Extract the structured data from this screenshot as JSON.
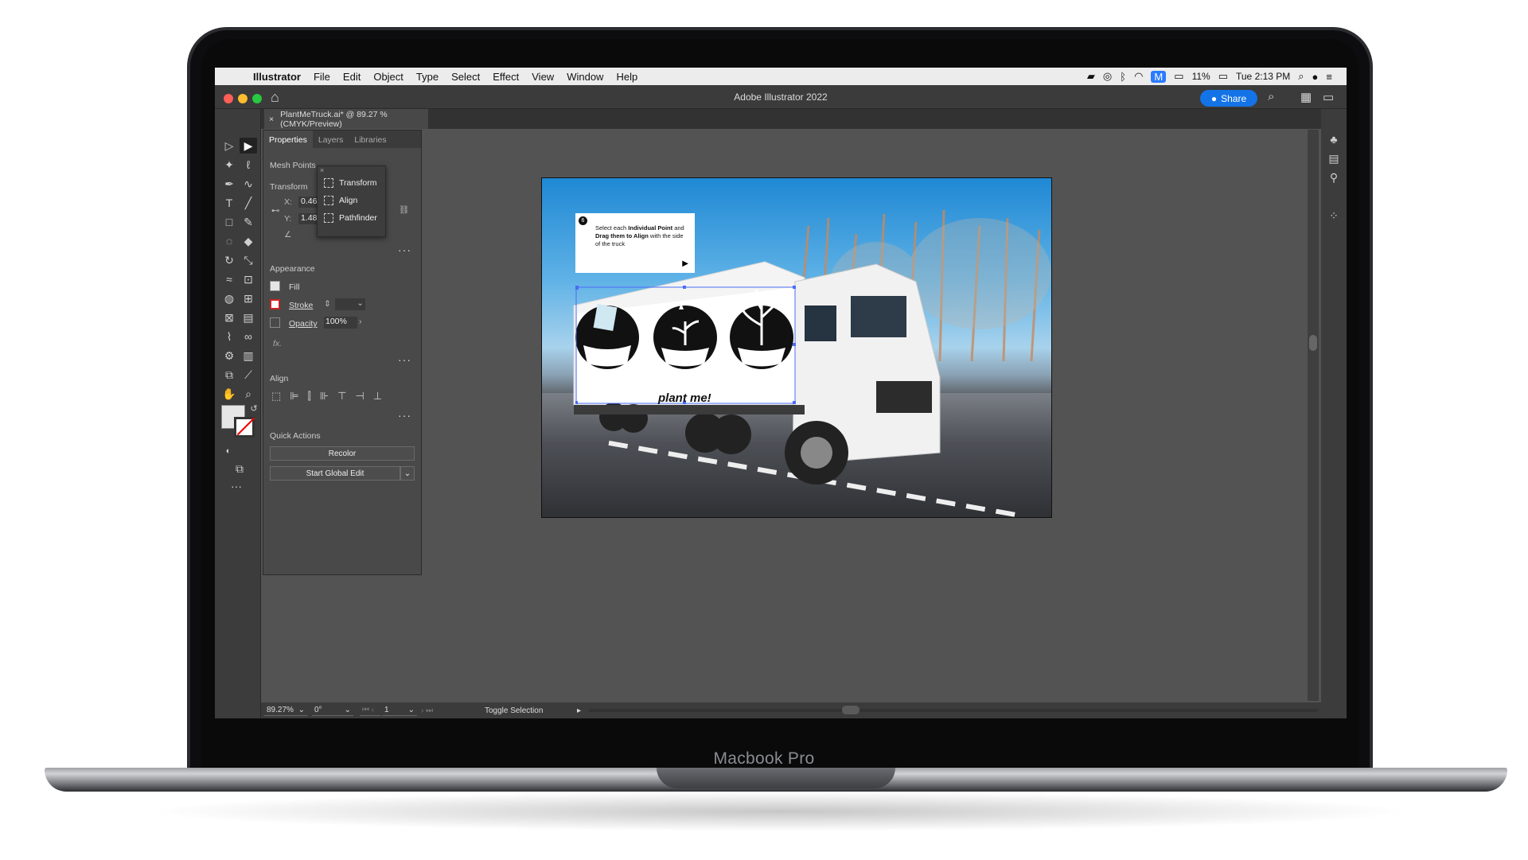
{
  "device": {
    "label": "Macbook Pro"
  },
  "menubar": {
    "app_name": "Illustrator",
    "items": [
      "File",
      "Edit",
      "Object",
      "Type",
      "Select",
      "Effect",
      "View",
      "Window",
      "Help"
    ],
    "battery": "11%",
    "clock": "Tue 2:13 PM"
  },
  "window": {
    "title": "Adobe Illustrator 2022",
    "share_label": "Share"
  },
  "document": {
    "tab_label": "PlantMeTruck.ai* @ 89.27 % (CMYK/Preview)"
  },
  "panel": {
    "tabs": [
      "Properties",
      "Layers",
      "Libraries"
    ],
    "selection_type": "Mesh Points",
    "transform": {
      "title": "Transform",
      "x_label": "X:",
      "x_value": "0.465",
      "y_label": "Y:",
      "y_value": "1.488"
    },
    "appearance": {
      "title": "Appearance",
      "fill_label": "Fill",
      "stroke_label": "Stroke",
      "opacity_label": "Opacity",
      "opacity_value": "100%",
      "fx_label": "fx."
    },
    "align": {
      "title": "Align"
    },
    "quick_actions": {
      "title": "Quick Actions",
      "recolor_label": "Recolor",
      "global_edit_label": "Start Global Edit"
    }
  },
  "popup_menu": {
    "items": [
      "Transform",
      "Align",
      "Pathfinder"
    ]
  },
  "artboard": {
    "step_number": "6",
    "instruction_parts": [
      "Select each ",
      "Individual Point",
      " and ",
      "Drag them to Align",
      " with the side of the truck"
    ],
    "truck_tagline": "plant me!"
  },
  "status_bar": {
    "zoom": "89.27%",
    "rotation": "0°",
    "artboard_number": "1",
    "status_text": "Toggle Selection"
  },
  "colors": {
    "accent": "#1473e6",
    "ui_dark": "#535353",
    "panel": "#494949"
  }
}
